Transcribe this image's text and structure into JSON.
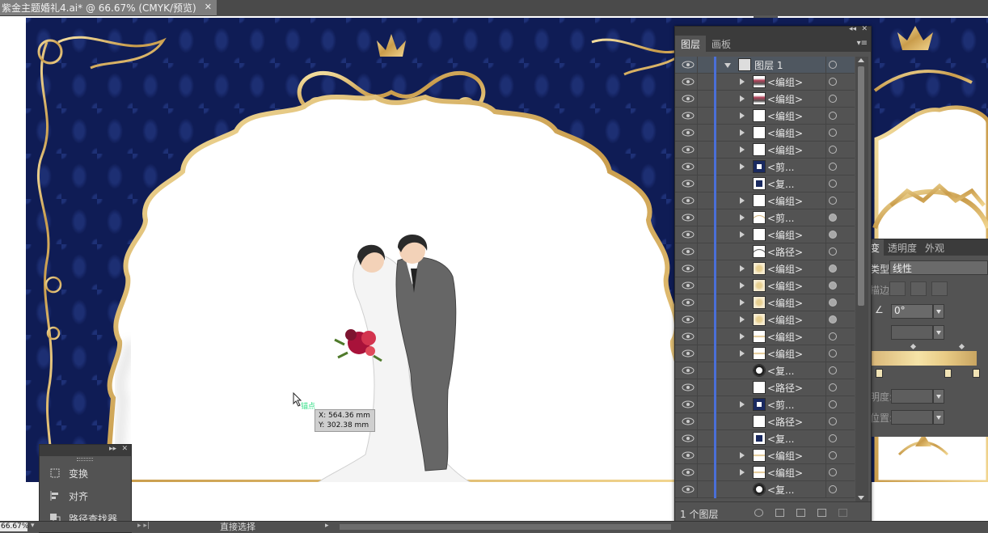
{
  "document": {
    "tab_title": "紫金主题婚礼4.ai* @ 66.67% (CMYK/预览)",
    "close_glyph": "✕"
  },
  "cursor": {
    "anchor_label": "锚点",
    "x_readout": "X: 564.36 mm",
    "y_readout": "Y: 302.38 mm"
  },
  "layers_panel": {
    "collapse_glyph": "◂◂",
    "close_glyph": "✕",
    "menu_glyph": "▾≡",
    "tabs": [
      "图层",
      "画板"
    ],
    "active_tab": "图层",
    "top_layer": "图层 1",
    "rows": [
      {
        "name": "<编组>",
        "expand": true,
        "target": "empty",
        "thumb": "figure"
      },
      {
        "name": "<编组>",
        "expand": true,
        "target": "empty",
        "thumb": "figure"
      },
      {
        "name": "<编组>",
        "expand": true,
        "target": "empty",
        "thumb": "blank"
      },
      {
        "name": "<编组>",
        "expand": true,
        "target": "empty",
        "thumb": "blank"
      },
      {
        "name": "<编组>",
        "expand": true,
        "target": "empty",
        "thumb": "blank"
      },
      {
        "name": "<剪...",
        "expand": true,
        "target": "empty",
        "thumb": "frame"
      },
      {
        "name": "<复...",
        "expand": false,
        "target": "empty",
        "thumb": "navy"
      },
      {
        "name": "<编组>",
        "expand": true,
        "target": "empty",
        "thumb": "blank"
      },
      {
        "name": "<剪...",
        "expand": true,
        "target": "filled",
        "thumb": "arch"
      },
      {
        "name": "<编组>",
        "expand": true,
        "target": "filled",
        "thumb": "blank"
      },
      {
        "name": "<路径>",
        "expand": false,
        "target": "empty",
        "thumb": "arch2"
      },
      {
        "name": "<编组>",
        "expand": true,
        "target": "filled",
        "thumb": "gold"
      },
      {
        "name": "<编组>",
        "expand": true,
        "target": "filled",
        "thumb": "gold"
      },
      {
        "name": "<编组>",
        "expand": true,
        "target": "filled",
        "thumb": "gold"
      },
      {
        "name": "<编组>",
        "expand": true,
        "target": "filled",
        "thumb": "gold"
      },
      {
        "name": "<编组>",
        "expand": true,
        "target": "empty",
        "thumb": "goldline"
      },
      {
        "name": "<编组>",
        "expand": true,
        "target": "empty",
        "thumb": "goldline"
      },
      {
        "name": "<复...",
        "expand": false,
        "target": "empty",
        "thumb": "ring"
      },
      {
        "name": "<路径>",
        "expand": false,
        "target": "empty",
        "thumb": "blank"
      },
      {
        "name": "<剪...",
        "expand": true,
        "target": "empty",
        "thumb": "frame"
      },
      {
        "name": "<路径>",
        "expand": false,
        "target": "empty",
        "thumb": "blank"
      },
      {
        "name": "<复...",
        "expand": false,
        "target": "empty",
        "thumb": "navy"
      },
      {
        "name": "<编组>",
        "expand": true,
        "target": "empty",
        "thumb": "goldline"
      },
      {
        "name": "<编组>",
        "expand": true,
        "target": "empty",
        "thumb": "goldline"
      },
      {
        "name": "<复...",
        "expand": false,
        "target": "empty",
        "thumb": "ring"
      }
    ],
    "footer_count": "1 个图层"
  },
  "gradient_panel": {
    "tabs": [
      "变",
      "透明度",
      "外观"
    ],
    "type_label": "类型:",
    "type_value": "线性",
    "stroke_label": "描边:",
    "angle_value": "0°",
    "opacity_label": "明度:",
    "location_label": "位置:"
  },
  "dock_panel": {
    "collapse_glyph": "▸▸",
    "close_glyph": "✕",
    "items": [
      "变换",
      "对齐",
      "路径查找器"
    ]
  },
  "status_bar": {
    "zoom": "66.67%",
    "tool": "直接选择"
  },
  "colors": {
    "navy": "#0f1c55",
    "gold": "#d9b46a",
    "layer_bar": "#4a6fd8",
    "panel_bg": "#535353"
  }
}
